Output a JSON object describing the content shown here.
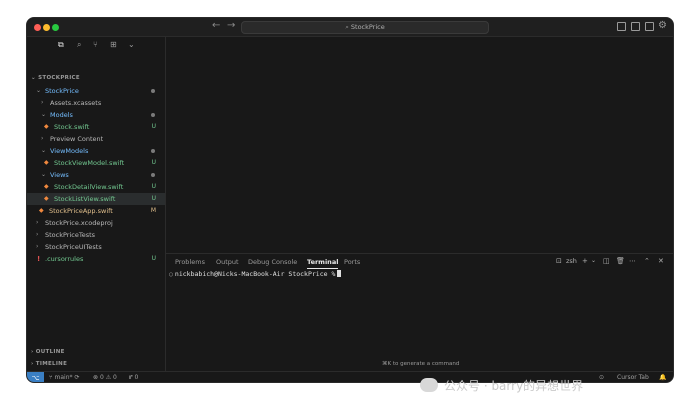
{
  "window": {
    "search_text": "StockPrice"
  },
  "sidebar": {
    "project_header": "STOCKPRICE",
    "outline_header": "OUTLINE",
    "timeline_header": "TIMELINE",
    "tree": [
      {
        "label": "StockPrice",
        "badge": ""
      },
      {
        "label": "Assets.xcassets",
        "badge": ""
      },
      {
        "label": "Models",
        "badge": ""
      },
      {
        "label": "Stock.swift",
        "badge": "U"
      },
      {
        "label": "Preview Content",
        "badge": ""
      },
      {
        "label": "ViewModels",
        "badge": ""
      },
      {
        "label": "StockViewModel.swift",
        "badge": "U"
      },
      {
        "label": "Views",
        "badge": ""
      },
      {
        "label": "StockDetailView.swift",
        "badge": "U"
      },
      {
        "label": "StockListView.swift",
        "badge": "U"
      },
      {
        "label": "StockPriceApp.swift",
        "badge": "M"
      },
      {
        "label": "StockPrice.xcodeproj",
        "badge": ""
      },
      {
        "label": "StockPriceTests",
        "badge": ""
      },
      {
        "label": "StockPriceUITests",
        "badge": ""
      },
      {
        "label": ".cursorrules",
        "badge": "U"
      }
    ]
  },
  "panel": {
    "tabs": [
      "Problems",
      "Output",
      "Debug Console",
      "Terminal",
      "Ports"
    ],
    "active_tab": "Terminal",
    "shell": "zsh",
    "prompt": "nickbabich@Nicks-MacBook-Air StockPrice %",
    "hint": "⌘K to generate a command"
  },
  "statusbar": {
    "branch": "main*",
    "errors": "0",
    "warnings": "0",
    "ports": "0",
    "right_label": "Cursor Tab"
  },
  "watermark": {
    "text": "公众号 · barry的异想世界"
  },
  "colors": {
    "accent": "#3a7fc4",
    "swift_icon": "#f0883e",
    "untracked": "#73c991",
    "modified": "#e2c08d",
    "folder": "#75beff"
  }
}
